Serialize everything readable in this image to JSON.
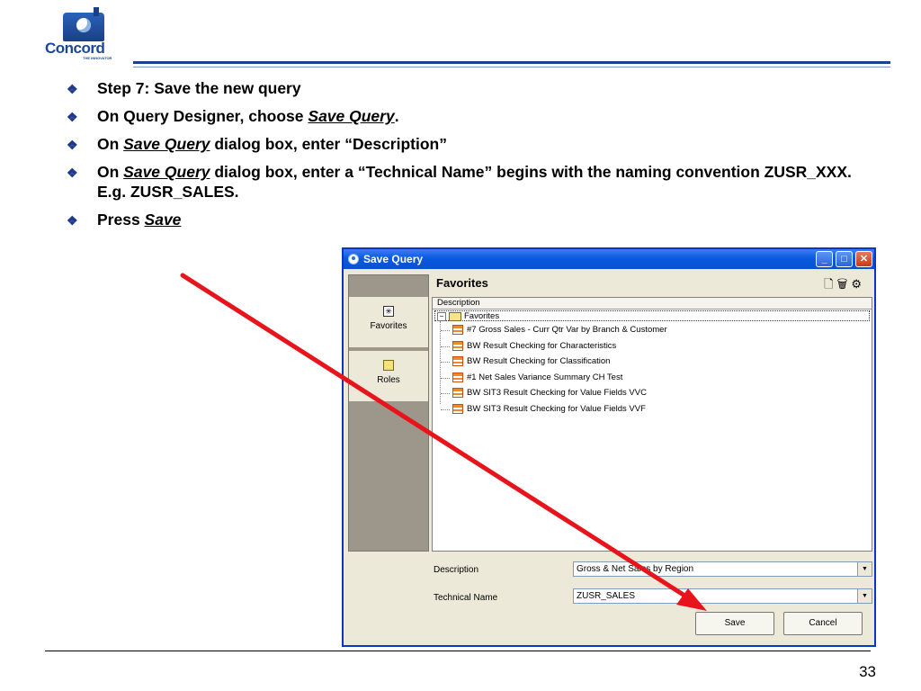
{
  "logo": {
    "name": "Concord",
    "tagline": "THE INNOVATOR"
  },
  "bullets": [
    {
      "parts": [
        {
          "text": "Step 7: Save the new query",
          "style": "normal"
        }
      ]
    },
    {
      "parts": [
        {
          "text": "On Query Designer, choose ",
          "style": "normal"
        },
        {
          "text": "Save Query",
          "style": "emph"
        },
        {
          "text": ".",
          "style": "normal"
        }
      ]
    },
    {
      "parts": [
        {
          "text": "On ",
          "style": "normal"
        },
        {
          "text": "Save Query",
          "style": "emph"
        },
        {
          "text": " dialog box, enter “Description”",
          "style": "normal"
        }
      ]
    },
    {
      "parts": [
        {
          "text": "On ",
          "style": "normal"
        },
        {
          "text": "Save Query",
          "style": "emph"
        },
        {
          "text": " dialog box, enter a “Technical Name” begins with the naming convention ZUSR_XXX.  E.g. ZUSR_SALES.",
          "style": "normal"
        }
      ]
    },
    {
      "parts": [
        {
          "text": "Press ",
          "style": "normal"
        },
        {
          "text": "Save",
          "style": "emph"
        }
      ]
    }
  ],
  "dialog": {
    "title": "Save Query",
    "header": "Favorites",
    "sidebar": [
      {
        "label": "Favorites",
        "icon": "favorites-icon"
      },
      {
        "label": "Roles",
        "icon": "roles-icon"
      }
    ],
    "tree": {
      "column_header": "Description",
      "root": "Favorites",
      "items": [
        "#7 Gross Sales - Curr Qtr Var by Branch & Customer",
        "BW Result Checking for Characteristics",
        "BW Result Checking for Classification",
        "#1 Net Sales Variance Summary CH Test",
        "BW SIT3 Result Checking for Value Fields VVC",
        "BW SIT3 Result Checking for Value Fields VVF"
      ]
    },
    "description_label": "Description",
    "description_value": "Gross & Net Sales by Region",
    "technical_name_label": "Technical Name",
    "technical_name_value": "ZUSR_SALES",
    "save_label": "Save",
    "cancel_label": "Cancel"
  },
  "page_number": "33",
  "colors": {
    "accent": "#1e3a8a",
    "arrow": "#e8141c",
    "title_bar": "#0a5ae0"
  }
}
